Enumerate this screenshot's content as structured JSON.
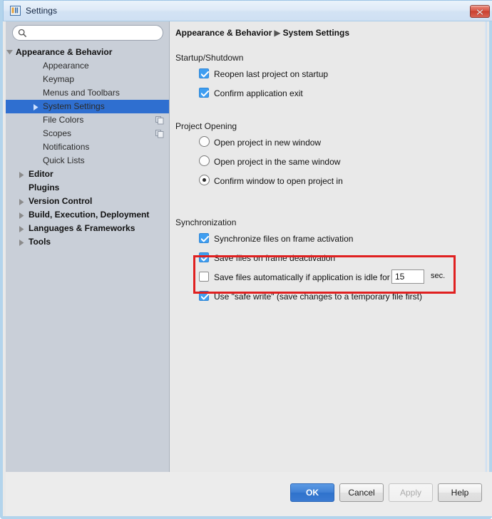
{
  "window": {
    "title": "Settings",
    "icon": "intellij-logo-icon",
    "close_icon": "close-icon"
  },
  "sidebar": {
    "search": {
      "value": "",
      "placeholder": "",
      "icon": "search-icon"
    },
    "items": [
      {
        "label": "Appearance & Behavior",
        "indent": 14,
        "arrow": "down",
        "bold": true,
        "selected": false,
        "icon": null
      },
      {
        "label": "Appearance",
        "indent": 52,
        "arrow": "none",
        "bold": false,
        "selected": false,
        "icon": null
      },
      {
        "label": "Keymap",
        "indent": 52,
        "arrow": "none",
        "bold": false,
        "selected": false,
        "icon": null
      },
      {
        "label": "Menus and Toolbars",
        "indent": 52,
        "arrow": "none",
        "bold": false,
        "selected": false,
        "icon": null
      },
      {
        "label": "System Settings",
        "indent": 52,
        "arrow": "right",
        "bold": false,
        "selected": true,
        "icon": null
      },
      {
        "label": "File Colors",
        "indent": 52,
        "arrow": "none",
        "bold": false,
        "selected": false,
        "icon": "copy-icon"
      },
      {
        "label": "Scopes",
        "indent": 52,
        "arrow": "none",
        "bold": false,
        "selected": false,
        "icon": "copy-icon"
      },
      {
        "label": "Notifications",
        "indent": 52,
        "arrow": "none",
        "bold": false,
        "selected": false,
        "icon": null
      },
      {
        "label": "Quick Lists",
        "indent": 52,
        "arrow": "none",
        "bold": false,
        "selected": false,
        "icon": null
      },
      {
        "label": "Editor",
        "indent": 32,
        "arrow": "right",
        "bold": true,
        "selected": false,
        "icon": null
      },
      {
        "label": "Plugins",
        "indent": 32,
        "arrow": "none",
        "bold": true,
        "selected": false,
        "icon": null
      },
      {
        "label": "Version Control",
        "indent": 32,
        "arrow": "right",
        "bold": true,
        "selected": false,
        "icon": null
      },
      {
        "label": "Build, Execution, Deployment",
        "indent": 32,
        "arrow": "right",
        "bold": true,
        "selected": false,
        "icon": null
      },
      {
        "label": "Languages & Frameworks",
        "indent": 32,
        "arrow": "right",
        "bold": true,
        "selected": false,
        "icon": null
      },
      {
        "label": "Tools",
        "indent": 32,
        "arrow": "right",
        "bold": true,
        "selected": false,
        "icon": null
      }
    ]
  },
  "content": {
    "breadcrumb": {
      "root": "Appearance & Behavior",
      "separator": "▶",
      "leaf": "System Settings"
    },
    "sections": [
      {
        "title": "Startup/Shutdown",
        "options": [
          {
            "type": "checkbox",
            "label": "Reopen last project on startup",
            "checked": true
          },
          {
            "type": "checkbox",
            "label": "Confirm application exit",
            "checked": true
          }
        ]
      },
      {
        "title": "Project Opening",
        "options": [
          {
            "type": "radio",
            "label": "Open project in new window",
            "checked": false
          },
          {
            "type": "radio",
            "label": "Open project in the same window",
            "checked": false
          },
          {
            "type": "radio",
            "label": "Confirm window to open project in",
            "checked": true
          }
        ]
      },
      {
        "title": "Synchronization",
        "options": [
          {
            "type": "checkbox",
            "label": "Synchronize files on frame activation",
            "checked": true
          },
          {
            "type": "checkbox",
            "label": "Save files on frame deactivation",
            "checked": true
          },
          {
            "type": "checkbox",
            "label": "Save files automatically if application is idle for",
            "checked": false,
            "field_value": "15",
            "field_suffix": "sec."
          },
          {
            "type": "checkbox",
            "label": "Use \"safe write\" (save changes to a temporary file first)",
            "checked": true
          }
        ]
      }
    ],
    "highlight": {
      "color": "#e02020",
      "label": "autosave-highlight"
    }
  },
  "buttons": [
    {
      "id": "ok",
      "label": "OK",
      "style": "primary",
      "disabled": false
    },
    {
      "id": "cancel",
      "label": "Cancel",
      "style": "normal",
      "disabled": false
    },
    {
      "id": "apply",
      "label": "Apply",
      "style": "disabled",
      "disabled": true
    },
    {
      "id": "help",
      "label": "Help",
      "style": "normal",
      "disabled": false
    }
  ],
  "colors": {
    "accent_blue": "#3f9ef1",
    "selection_blue": "#2f6fd0",
    "highlight_red": "#e02020",
    "sidebar_bg": "#c9cfd8",
    "content_bg": "#e9e9e9"
  }
}
